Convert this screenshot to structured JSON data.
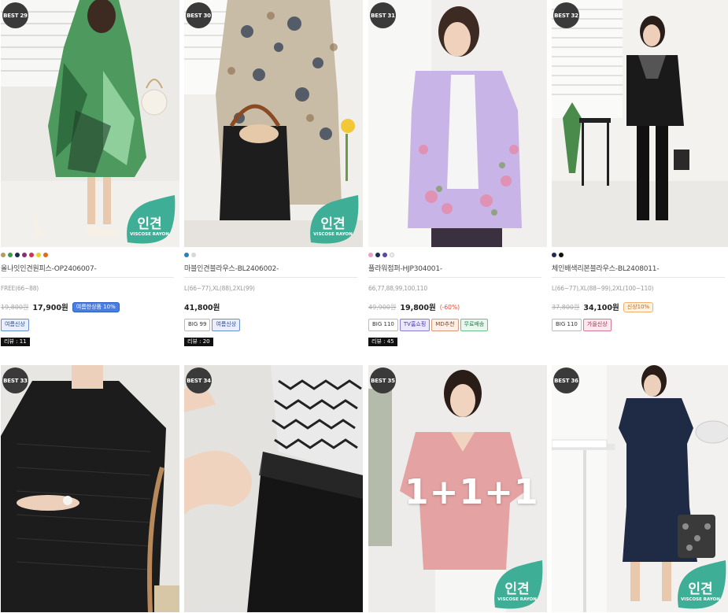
{
  "products": [
    {
      "best": "BEST 29",
      "swatches": [
        "#b79b5a",
        "#3d9a4a",
        "#1e2b54",
        "#8b2d6e",
        "#d4305c",
        "#e8d32c",
        "#e06b1c"
      ],
      "name": "올나잇인견원피스-OP2406007-",
      "size": "FREE(66~88)",
      "old_price": "19,800원",
      "price": "17,900원",
      "discount": "",
      "promo_badge": "여름한상품 10%",
      "tags": [
        {
          "label": "여름신상",
          "style": "summer"
        }
      ],
      "review": "리뷰 : 11",
      "fabric_badge": {
        "title": "인견",
        "sub": "VISCOSE RAYON"
      }
    },
    {
      "best": "BEST 30",
      "swatches": [
        "#2d7fb8",
        "#d8d8d8"
      ],
      "name": "마블인견블라우스-BL2406002-",
      "size": "L(66~77),XL(88),2XL(99)",
      "old_price": "",
      "price": "41,800원",
      "discount": "",
      "promo_badge": "",
      "tags": [
        {
          "label": "BIG 99",
          "style": "plain"
        },
        {
          "label": "여름신상",
          "style": "summer"
        }
      ],
      "review": "리뷰 : 20",
      "fabric_badge": {
        "title": "인견",
        "sub": "VISCOSE RAYON"
      }
    },
    {
      "best": "BEST 31",
      "swatches": [
        "#e6a2c6",
        "#1e2b54",
        "#5a4aa8",
        "#f0f0f0"
      ],
      "name": "플라워점퍼-HJP304001-",
      "size": "66,77,88,99,100,110",
      "old_price": "49,900원",
      "price": "19,800원",
      "discount": "(-60%)",
      "promo_badge": "",
      "tags": [
        {
          "label": "BIG 110",
          "style": "plain"
        },
        {
          "label": "TV홈쇼핑",
          "style": "tv"
        },
        {
          "label": "MD추천",
          "style": "md"
        },
        {
          "label": "무료배송",
          "style": "free"
        }
      ],
      "review": "리뷰 : 45",
      "fabric_badge": null
    },
    {
      "best": "BEST 32",
      "swatches": [
        "#1e2b54",
        "#111111"
      ],
      "name": "체인배색리본블라우스-BL2408011-",
      "size": "L(66~77),XL(88~99),2XL(100~110)",
      "old_price": "37,800원",
      "price": "34,100원",
      "discount": "",
      "promo_badge": "신상10%",
      "tags": [
        {
          "label": "BIG 110",
          "style": "plain"
        },
        {
          "label": "가을신상",
          "style": "fall"
        }
      ],
      "review": "",
      "fabric_badge": null
    },
    {
      "best": "BEST 33",
      "fabric_badge": null,
      "promo_text": ""
    },
    {
      "best": "BEST 34",
      "fabric_badge": null,
      "promo_text": ""
    },
    {
      "best": "BEST 35",
      "fabric_badge": {
        "title": "인견",
        "sub": "VISCOSE RAYON"
      },
      "promo_text": "1+1+1"
    },
    {
      "best": "BEST 36",
      "fabric_badge": {
        "title": "인견",
        "sub": "VISCOSE RAYON"
      },
      "promo_text": ""
    }
  ],
  "colors": {
    "fabric_badge": "#3fae96",
    "best_badge": "#3a3a3a",
    "promo_summer_bg": "#4a7fe0"
  }
}
